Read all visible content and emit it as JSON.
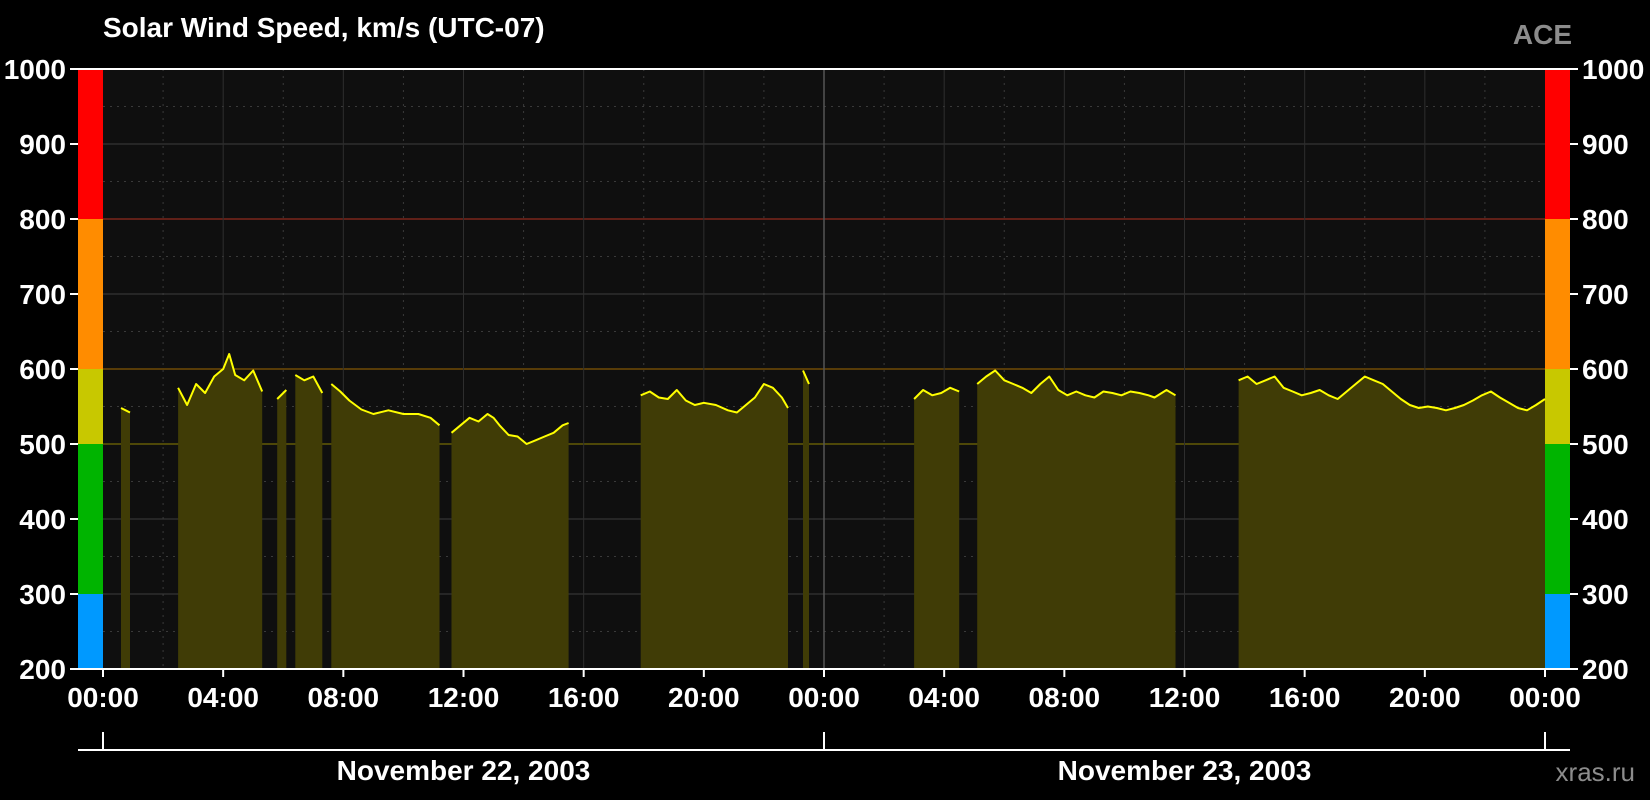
{
  "header": {
    "title": "Solar Wind Speed, km/s (UTC-07)",
    "source": "ACE",
    "watermark": "xras.ru"
  },
  "chart_data": {
    "type": "area",
    "title": "Solar Wind Speed, km/s (UTC-07)",
    "xlabel": "",
    "ylabel": "",
    "ylim": [
      200,
      1000
    ],
    "yticks": [
      "200",
      "300",
      "400",
      "500",
      "600",
      "700",
      "800",
      "900",
      "1000"
    ],
    "xlim_hours": [
      0,
      48
    ],
    "xtick_labels": [
      "00:00",
      "04:00",
      "08:00",
      "12:00",
      "16:00",
      "20:00",
      "00:00",
      "04:00",
      "08:00",
      "12:00",
      "16:00",
      "20:00",
      "00:00"
    ],
    "date_labels": [
      "November 22, 2003",
      "November 23, 2003"
    ],
    "grid": true,
    "threshold_lines": [
      500,
      600,
      800
    ],
    "scale_bands": [
      {
        "from": 200,
        "to": 300,
        "color": "#0099ff"
      },
      {
        "from": 300,
        "to": 500,
        "color": "#00b400"
      },
      {
        "from": 500,
        "to": 600,
        "color": "#c8c800"
      },
      {
        "from": 600,
        "to": 800,
        "color": "#ff8c00"
      },
      {
        "from": 800,
        "to": 1000,
        "color": "#ff0000"
      }
    ],
    "colors": {
      "line": "#ffff00",
      "fill": "#403c06",
      "plot_bg": "#0f0f0f"
    },
    "series": [
      {
        "segments": [
          [
            [
              0.6,
              548
            ],
            [
              0.9,
              542
            ]
          ],
          [
            [
              2.5,
              575
            ],
            [
              2.8,
              552
            ],
            [
              3.1,
              580
            ],
            [
              3.4,
              568
            ],
            [
              3.7,
              590
            ],
            [
              4.0,
              600
            ],
            [
              4.2,
              620
            ],
            [
              4.4,
              592
            ],
            [
              4.7,
              585
            ],
            [
              5.0,
              598
            ],
            [
              5.3,
              570
            ]
          ],
          [
            [
              5.8,
              560
            ],
            [
              6.1,
              572
            ]
          ],
          [
            [
              6.4,
              592
            ],
            [
              6.7,
              585
            ],
            [
              7.0,
              590
            ],
            [
              7.3,
              568
            ]
          ],
          [
            [
              7.6,
              580
            ],
            [
              7.9,
              570
            ],
            [
              8.2,
              558
            ],
            [
              8.6,
              546
            ],
            [
              9.0,
              540
            ],
            [
              9.5,
              545
            ],
            [
              10.0,
              540
            ],
            [
              10.5,
              540
            ],
            [
              10.9,
              535
            ],
            [
              11.2,
              525
            ]
          ],
          [
            [
              11.6,
              515
            ],
            [
              11.9,
              525
            ],
            [
              12.2,
              535
            ],
            [
              12.5,
              530
            ],
            [
              12.8,
              540
            ],
            [
              13.0,
              535
            ],
            [
              13.2,
              525
            ],
            [
              13.5,
              512
            ],
            [
              13.8,
              510
            ],
            [
              14.1,
              500
            ],
            [
              14.4,
              505
            ],
            [
              14.7,
              510
            ],
            [
              15.0,
              515
            ],
            [
              15.3,
              525
            ],
            [
              15.5,
              528
            ]
          ],
          [
            [
              17.9,
              565
            ],
            [
              18.2,
              570
            ],
            [
              18.5,
              562
            ],
            [
              18.8,
              560
            ],
            [
              19.1,
              572
            ],
            [
              19.4,
              558
            ],
            [
              19.7,
              552
            ],
            [
              20.0,
              555
            ],
            [
              20.4,
              552
            ],
            [
              20.8,
              545
            ],
            [
              21.1,
              542
            ],
            [
              21.4,
              552
            ],
            [
              21.7,
              562
            ],
            [
              22.0,
              580
            ],
            [
              22.3,
              575
            ],
            [
              22.6,
              562
            ],
            [
              22.8,
              548
            ]
          ],
          [
            [
              23.3,
              598
            ],
            [
              23.5,
              580
            ]
          ],
          [
            [
              27.0,
              560
            ],
            [
              27.3,
              572
            ],
            [
              27.6,
              565
            ],
            [
              27.9,
              568
            ],
            [
              28.2,
              575
            ],
            [
              28.5,
              570
            ]
          ],
          [
            [
              29.1,
              580
            ],
            [
              29.4,
              590
            ],
            [
              29.7,
              598
            ],
            [
              30.0,
              585
            ],
            [
              30.3,
              580
            ],
            [
              30.6,
              575
            ],
            [
              30.9,
              568
            ],
            [
              31.2,
              580
            ],
            [
              31.5,
              590
            ],
            [
              31.8,
              572
            ],
            [
              32.1,
              565
            ],
            [
              32.4,
              570
            ],
            [
              32.7,
              565
            ],
            [
              33.0,
              562
            ],
            [
              33.3,
              570
            ],
            [
              33.6,
              568
            ],
            [
              33.9,
              565
            ],
            [
              34.2,
              570
            ],
            [
              34.5,
              568
            ],
            [
              34.8,
              565
            ],
            [
              35.0,
              562
            ],
            [
              35.4,
              572
            ],
            [
              35.7,
              565
            ]
          ],
          [
            [
              37.8,
              585
            ],
            [
              38.1,
              590
            ],
            [
              38.4,
              580
            ],
            [
              38.7,
              585
            ],
            [
              39.0,
              590
            ],
            [
              39.3,
              575
            ],
            [
              39.6,
              570
            ],
            [
              39.9,
              565
            ],
            [
              40.2,
              568
            ],
            [
              40.5,
              572
            ],
            [
              40.8,
              565
            ],
            [
              41.1,
              560
            ],
            [
              41.4,
              570
            ],
            [
              41.7,
              580
            ],
            [
              42.0,
              590
            ],
            [
              42.3,
              585
            ],
            [
              42.6,
              580
            ],
            [
              42.9,
              570
            ],
            [
              43.2,
              560
            ],
            [
              43.5,
              552
            ],
            [
              43.8,
              548
            ],
            [
              44.1,
              550
            ],
            [
              44.4,
              548
            ],
            [
              44.7,
              545
            ],
            [
              45.0,
              548
            ],
            [
              45.3,
              552
            ],
            [
              45.6,
              558
            ],
            [
              45.9,
              565
            ],
            [
              46.2,
              570
            ],
            [
              46.5,
              562
            ],
            [
              46.8,
              555
            ],
            [
              47.1,
              548
            ],
            [
              47.4,
              545
            ],
            [
              47.7,
              552
            ],
            [
              48.0,
              560
            ]
          ]
        ]
      }
    ]
  }
}
